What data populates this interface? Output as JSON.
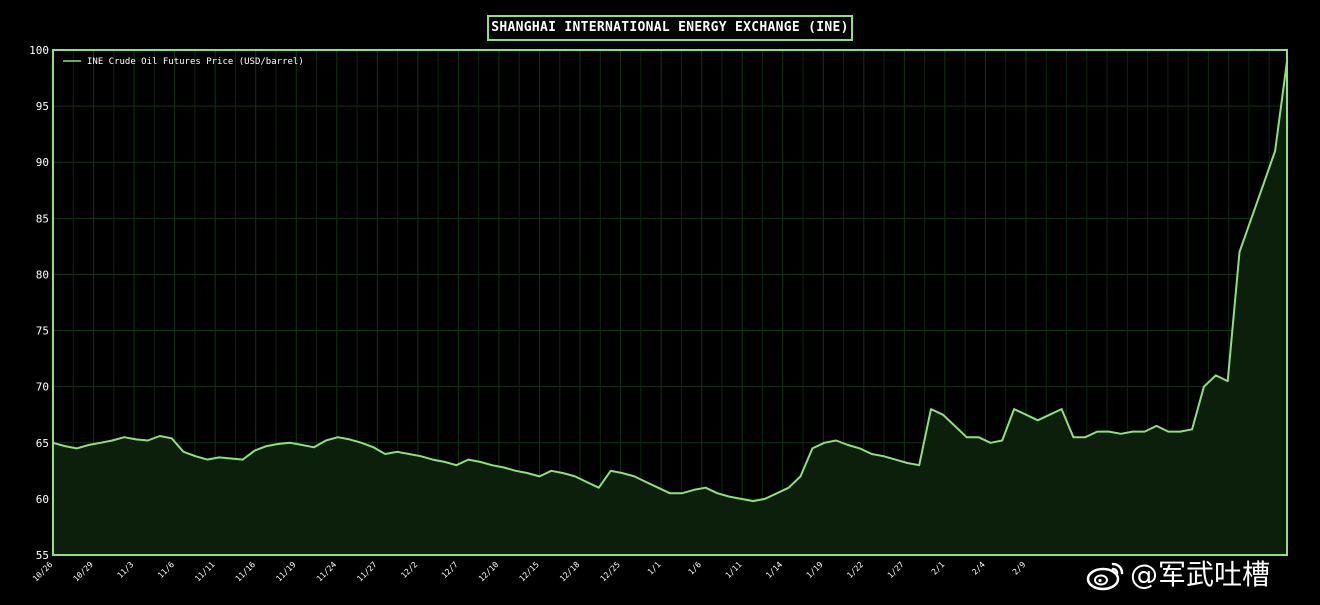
{
  "chart_data": {
    "type": "area",
    "title": "SHANGHAI INTERNATIONAL ENERGY EXCHANGE (INE)",
    "xlabel": "",
    "ylabel": "",
    "ylim": [
      55,
      100
    ],
    "yticks": [
      55,
      60,
      65,
      70,
      75,
      80,
      85,
      90,
      95,
      100
    ],
    "grid": true,
    "legend": "top-left",
    "x_tick_labels": [
      "10/26",
      "10/29",
      "11/3",
      "11/6",
      "11/11",
      "11/16",
      "11/19",
      "11/24",
      "11/27",
      "12/2",
      "12/7",
      "12/10",
      "12/15",
      "12/18",
      "12/25",
      "1/1",
      "1/6",
      "1/11",
      "1/14",
      "1/19",
      "1/22",
      "1/27",
      "2/1",
      "2/4",
      "2/9"
    ],
    "series": [
      {
        "name": "INE Crude Oil Futures Price (USD/barrel)",
        "color": "#8fe07a",
        "values": [
          65.0,
          64.7,
          64.5,
          64.8,
          65.0,
          65.2,
          65.5,
          65.3,
          65.2,
          65.6,
          65.4,
          64.2,
          63.8,
          63.5,
          63.7,
          63.6,
          63.5,
          64.3,
          64.7,
          64.9,
          65.0,
          64.8,
          64.6,
          65.2,
          65.5,
          65.3,
          65.0,
          64.6,
          64.0,
          64.2,
          64.0,
          63.8,
          63.5,
          63.3,
          63.0,
          63.5,
          63.3,
          63.0,
          62.8,
          62.5,
          62.3,
          62.0,
          62.5,
          62.3,
          62.0,
          61.5,
          61.0,
          62.5,
          62.3,
          62.0,
          61.5,
          61.0,
          60.5,
          60.5,
          60.8,
          61.0,
          60.5,
          60.2,
          60.0,
          59.8,
          60.0,
          60.5,
          61.0,
          62.0,
          64.5,
          65.0,
          65.2,
          64.8,
          64.5,
          64.0,
          63.8,
          63.5,
          63.2,
          63.0,
          68.0,
          67.5,
          66.5,
          65.5,
          65.5,
          65.0,
          65.2,
          68.0,
          67.5,
          67.0,
          67.5,
          68.0,
          65.5,
          65.5,
          66.0,
          66.0,
          65.8,
          66.0,
          66.0,
          66.5,
          66.0,
          66.0,
          66.2,
          70.0,
          71.0,
          70.5,
          82.0,
          85.0,
          88.0,
          91.0,
          99.0
        ]
      }
    ]
  },
  "watermark": {
    "icon": "weibo-icon",
    "text": "@军武吐槽"
  }
}
